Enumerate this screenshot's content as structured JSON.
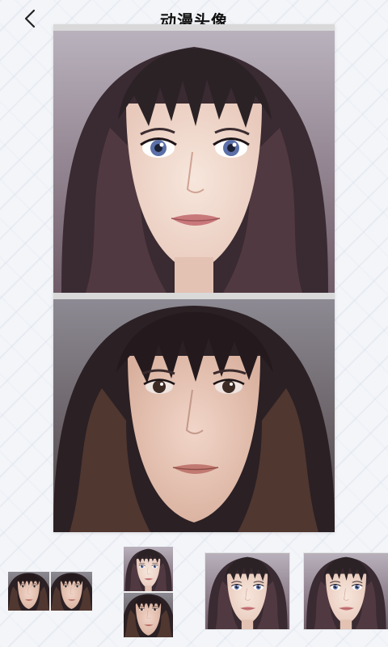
{
  "header": {
    "title": "动漫头像",
    "back_icon": "chevron-left-icon"
  },
  "comparison": {
    "top_style": "anime",
    "bottom_style": "original"
  },
  "style_thumbnails": [
    {
      "name": "side-by-side"
    },
    {
      "name": "stacked"
    },
    {
      "name": "anime-1"
    },
    {
      "name": "anime-2"
    }
  ],
  "colors": {
    "background": "#f3f5f9",
    "hair": "#2b2226",
    "skin": "#efd8cc",
    "lips": "#c9787a"
  }
}
